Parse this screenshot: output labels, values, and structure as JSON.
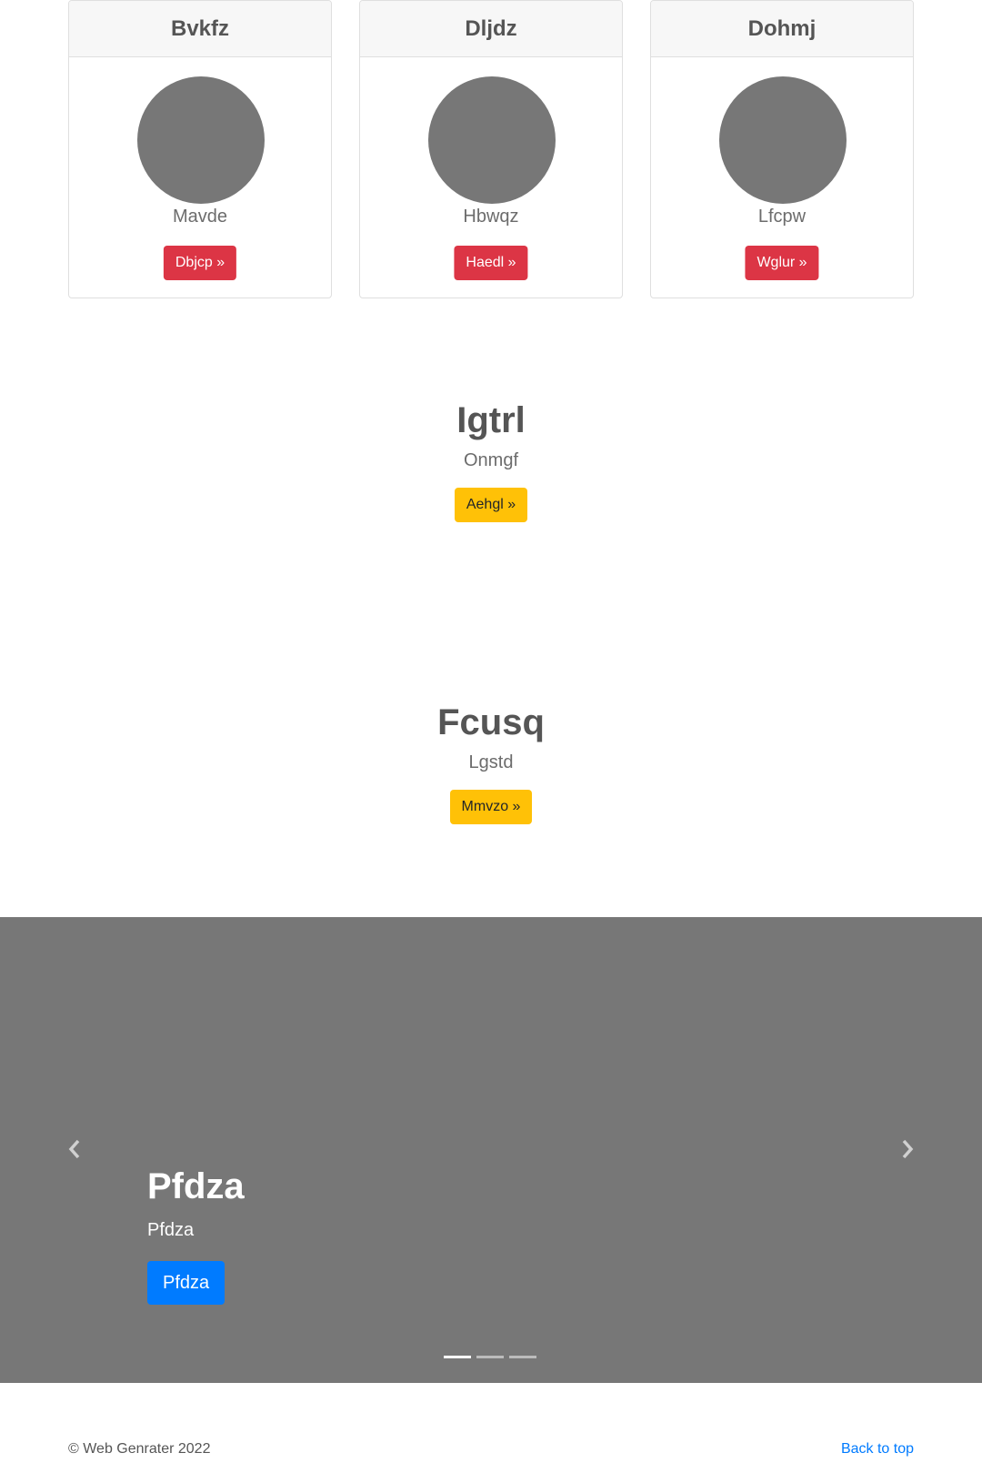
{
  "cards": [
    {
      "title": "Bvkfz",
      "text": "Mavde",
      "button": "Dbjcp »"
    },
    {
      "title": "Dljdz",
      "text": "Hbwqz",
      "button": "Haedl »"
    },
    {
      "title": "Dohmj",
      "text": "Lfcpw",
      "button": "Wglur »"
    }
  ],
  "features": [
    {
      "heading": "Igtrl",
      "text": "Onmgf",
      "button": "Aehgl »"
    },
    {
      "heading": "Fcusq",
      "text": "Lgstd",
      "button": "Mmvzo »"
    }
  ],
  "carousel": {
    "caption_title": "Pfdza",
    "caption_text": "Pfdza",
    "caption_button": "Pfdza",
    "prev_icon": "chevron-left-icon",
    "next_icon": "chevron-right-icon",
    "indicator_count": 3,
    "active_index": 0
  },
  "footer": {
    "copyright": "© Web Genrater 2022",
    "back_to_top": "Back to top"
  },
  "colors": {
    "danger": "#dc3545",
    "warning": "#ffc107",
    "primary": "#007bff",
    "placeholder_gray": "#777777"
  }
}
